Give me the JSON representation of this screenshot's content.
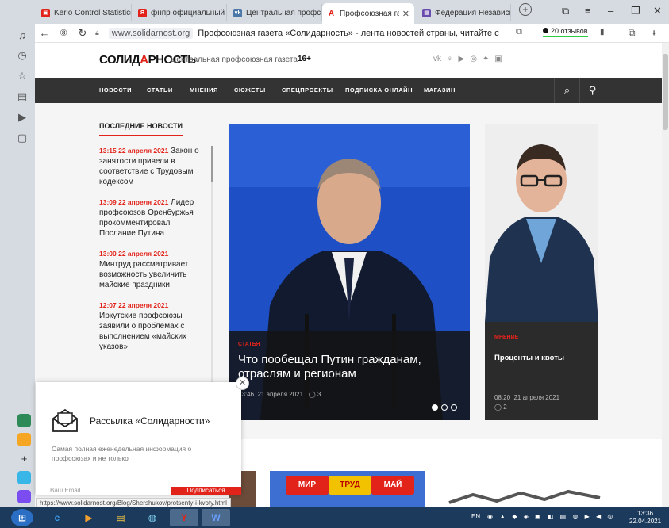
{
  "tabs": [
    {
      "label": "Kerio Control Statistics",
      "fav_color": "#e2231a",
      "fav_glyph": "▣"
    },
    {
      "label": "фнпр официальный са",
      "fav_color": "#e2231a",
      "fav_glyph": "Я"
    },
    {
      "label": "Центральная профсою",
      "fav_color": "#4a76a8",
      "fav_glyph": "vk"
    },
    {
      "label": "Профсоюзная газета",
      "fav_color": "#e2231a",
      "fav_glyph": "A",
      "active": true
    },
    {
      "label": "Федерация Независим",
      "fav_color": "#6a4caf",
      "fav_glyph": "▦"
    }
  ],
  "address": {
    "domain": "www.solidarnost.org",
    "title": "Профсоюзная газета «Солидарность» - лента новостей страны, читайте ста...",
    "reviews": "20 отзывов"
  },
  "site": {
    "logo_left": "СОЛИД",
    "logo_a": "А",
    "logo_right": "РНОСТЬ",
    "tagline": "Центральная профсоюзная газета",
    "age": "16+",
    "social_icons": [
      "vk-icon",
      "ok-icon",
      "youtube-icon",
      "instagram-icon",
      "twitter-icon",
      "telegram-icon"
    ]
  },
  "nav": [
    "НОВОСТИ",
    "СТАТЬИ",
    "МНЕНИЯ",
    "СЮЖЕТЫ",
    "СПЕЦПРОЕКТЫ",
    "ПОДПИСКА ОНЛАЙН",
    "МАГАЗИН"
  ],
  "latest": {
    "heading": "ПОСЛЕДНИЕ НОВОСТИ",
    "items": [
      {
        "time": "13:15 22 апреля 2021",
        "text": "Закон о занятости привели в соответствие с Трудовым кодексом"
      },
      {
        "time": "13:09 22 апреля 2021",
        "text": "Лидер профсоюзов Оренбуржья прокомментировал Послание Путина"
      },
      {
        "time": "13:00 22 апреля 2021",
        "text": "Минтруд рассматривает возможность увеличить майские праздники"
      },
      {
        "time": "12:07 22 апреля 2021",
        "text": "Иркутские профсоюзы заявили о проблемах с выполнением «майских указов»"
      }
    ]
  },
  "hero": {
    "category": "СТАТЬЯ",
    "title": "Что пообещал Путин гражданам, отраслям и регионам",
    "time": "13:46",
    "date": "21 апреля 2021",
    "comments": "3"
  },
  "opinion": {
    "category": "МНЕНИЕ",
    "title": "Проценты и квоты",
    "time": "08:20",
    "date": "21 апреля 2021",
    "comments": "2"
  },
  "thumbs": {
    "flags": [
      "МИР",
      "ТРУД",
      "МАЙ"
    ]
  },
  "popup": {
    "title": "Рассылка «Солидарности»",
    "desc": "Самая полная еженедельная информация о профсоюзах и не только",
    "email_placeholder": "Ваш Email",
    "subscribe": "Подписаться"
  },
  "status_url": "https://www.solidarnost.org/Blog/Shershukov/protsenty-i-kvoty.html",
  "taskbar": {
    "lang": "EN",
    "time": "13:36",
    "date": "22.04.2021"
  }
}
